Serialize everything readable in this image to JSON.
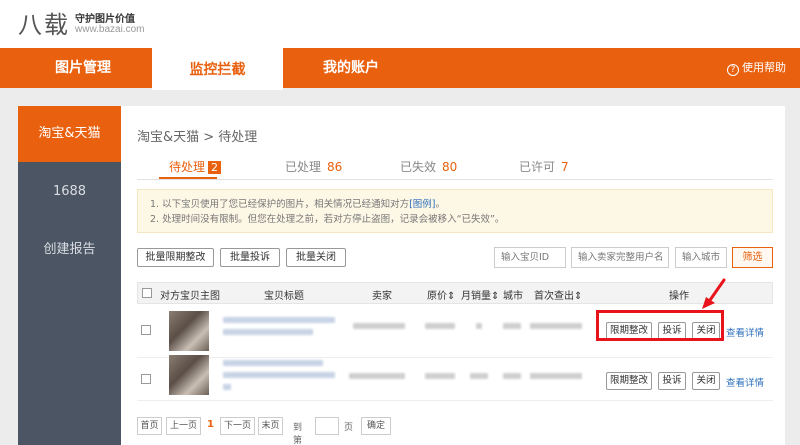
{
  "logo": {
    "name": "八载",
    "tagline": "守护图片价值",
    "url": "www.bazai.com"
  },
  "nav": {
    "items": [
      "图片管理",
      "监控拦截",
      "我的账户"
    ],
    "active": "监控拦截",
    "help_label": "使用帮助",
    "help_icon": "?"
  },
  "sidebar": {
    "items": [
      "淘宝&天猫",
      "1688",
      "创建报告"
    ],
    "active": "淘宝&天猫"
  },
  "breadcrumb": "淘宝&天猫 > 待处理",
  "tabs": [
    {
      "label": "待处理",
      "count": "2"
    },
    {
      "label": "已处理",
      "count": "86"
    },
    {
      "label": "已失效",
      "count": "80"
    },
    {
      "label": "已许可",
      "count": "7"
    }
  ],
  "notice": {
    "line1_prefix": "1. 以下宝贝使用了您已经保护的图片，相关情况已经通知对方",
    "line1_link": "[图例]",
    "line1_suffix": "。",
    "line2": "2. 处理时间没有限制。但您在处理之前，若对方停止盗图，记录会被移入“已失效”。"
  },
  "bulk_actions": [
    "批量限期整改",
    "批量投诉",
    "批量关闭"
  ],
  "filters": {
    "item_id_placeholder": "输入宝贝ID",
    "seller_placeholder": "输入卖家完整用户名",
    "city_placeholder": "输入城市",
    "filter_label": "筛选"
  },
  "table": {
    "headers": [
      "对方宝贝主图",
      "宝贝标题",
      "卖家",
      "原价",
      "月销量",
      "城市",
      "首次查出",
      "操作"
    ],
    "sort_glyph": "⇕",
    "rows": [
      {
        "actions": [
          "限期整改",
          "投诉",
          "关闭"
        ],
        "detail_link": "查看详情"
      },
      {
        "actions": [
          "限期整改",
          "投诉",
          "关闭"
        ],
        "detail_link": "查看详情"
      }
    ]
  },
  "pager": {
    "first": "首页",
    "prev": "上一页",
    "current": "1",
    "next": "下一页",
    "last": "末页",
    "goto_label": "到第",
    "page_unit": "页",
    "confirm": "确定"
  },
  "colors": {
    "brand": "#e9600e",
    "sidebar": "#4b5563",
    "highlight": "#e8131b",
    "link": "#2d6fbd"
  }
}
